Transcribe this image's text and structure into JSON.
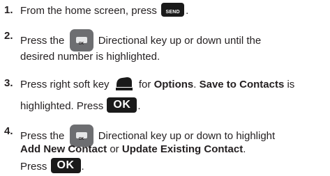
{
  "steps": [
    {
      "number": "1.",
      "line1_before": "From the home screen, press",
      "line1_after": "."
    },
    {
      "number": "2.",
      "line1_before": "Press the",
      "line1_after": "Directional key up or down until the",
      "line2": "desired number is highlighted."
    },
    {
      "number": "3.",
      "line1_before": "Press right soft key",
      "line1_mid": "for",
      "bold_options": "Options",
      "line1_sep": ".",
      "bold_save": "Save to Contacts",
      "line1_after": "is",
      "line2_before": "highlighted. Press",
      "line2_after": "."
    },
    {
      "number": "4.",
      "line1_before": "Press the",
      "line1_after": "Directional key up or down to highlight",
      "bold_add": "Add New Contact",
      "line2_or": "or",
      "bold_update": "Update Existing Contact",
      "line2_after": ".",
      "line3_before": "Press",
      "line3_after": "."
    }
  ],
  "keys": {
    "send_label": "SEND",
    "directional_label": "OK",
    "ok_label": "OK",
    "send_icon": "send-key-icon",
    "directional_icon": "directional-key-icon",
    "soft_key_icon": "right-soft-key-icon",
    "ok_icon": "ok-key-icon"
  },
  "colors": {
    "text": "#231f20",
    "key_dark": "#1a1a1a",
    "key_gray": "#6d6e71"
  }
}
